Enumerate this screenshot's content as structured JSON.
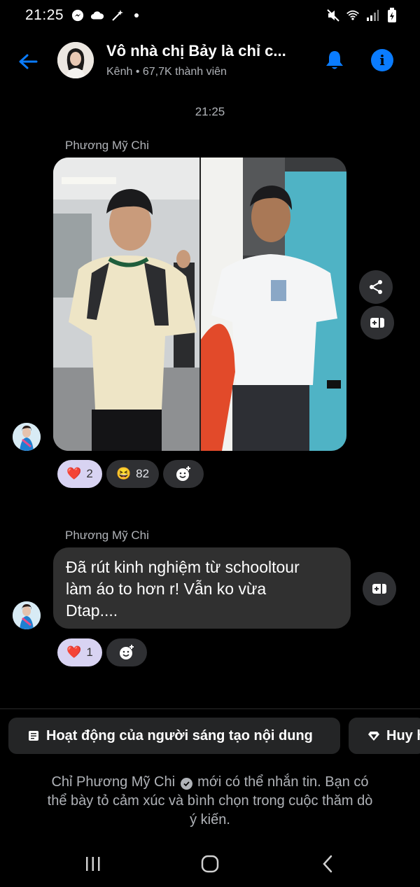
{
  "status_bar": {
    "time": "21:25",
    "icons_left": [
      "messenger-icon",
      "cloud-icon",
      "magic-wand-icon",
      "dot-icon"
    ],
    "icons_right": [
      "mute-icon",
      "wifi-icon",
      "signal-icon",
      "battery-icon"
    ]
  },
  "header": {
    "title": "Vô nhà chị Bảy là chỉ c...",
    "subtitle": "Kênh • 67,7K thành viên"
  },
  "timestamp": "21:25",
  "messages": [
    {
      "sender": "Phương Mỹ Chi",
      "type": "image",
      "reactions": [
        {
          "emoji": "❤️",
          "count": "2"
        },
        {
          "emoji": "😆",
          "count": "82"
        }
      ]
    },
    {
      "sender": "Phương Mỹ Chi",
      "type": "text",
      "lines": [
        "Đã rút kinh nghiệm từ schooltour",
        "làm áo to hơn r! Vẫn ko vừa",
        "Dtap...."
      ],
      "reactions": [
        {
          "emoji": "❤️",
          "count": "1"
        }
      ]
    }
  ],
  "chips": [
    {
      "label": "Hoạt động của người sáng tạo nội dung"
    },
    {
      "label": "Huy h"
    }
  ],
  "footer": {
    "line1_before": "Chỉ Phương Mỹ Chi",
    "line1_after": "mới có thể nhắn tin. Bạn có",
    "line2": "thể bày tỏ cảm xúc và bình chọn trong cuộc thăm dò",
    "line3": "ý kiến."
  },
  "colors": {
    "accent": "#0a7cff",
    "bubble": "#303030",
    "reaction_active": "#d8d3f2"
  }
}
